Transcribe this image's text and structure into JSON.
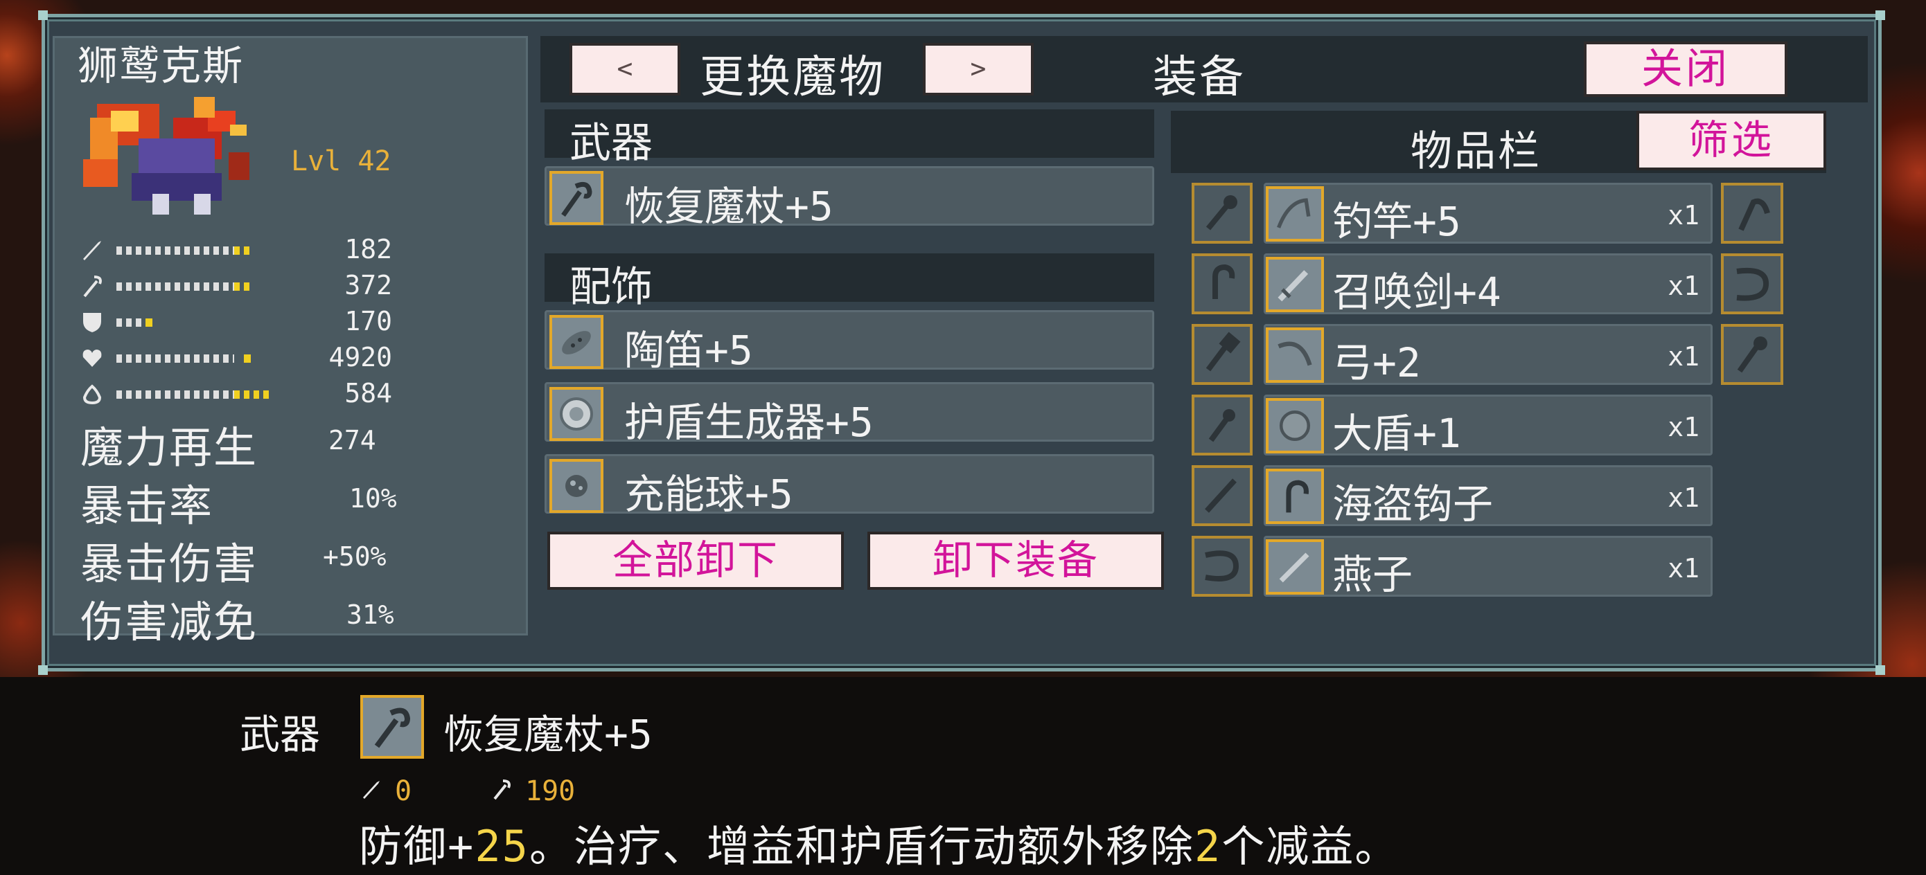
{
  "monster": {
    "name": "狮鹫克斯",
    "level": "Lvl 42",
    "stats": [
      {
        "icon": "sword-icon",
        "value": "182",
        "bar": 0.7
      },
      {
        "icon": "staff-icon",
        "value": "372",
        "bar": 0.7
      },
      {
        "icon": "shield-icon",
        "value": "170",
        "bar": 0.4
      },
      {
        "icon": "heart-icon",
        "value": "4920",
        "bar": 0.8
      },
      {
        "icon": "mana-icon",
        "value": "584",
        "bar": 0.95
      }
    ],
    "extra_stats": [
      {
        "label": "魔力再生",
        "value": "274"
      },
      {
        "label": "暴击率",
        "value": "10%"
      },
      {
        "label": "暴击伤害",
        "value": "+50%"
      },
      {
        "label": "伤害减免",
        "value": "31%"
      }
    ]
  },
  "header": {
    "prev_label": "<",
    "change_label": "更换魔物",
    "next_label": ">",
    "equip_label": "装备",
    "close_label": "关闭"
  },
  "equipped": {
    "weapon_title": "武器",
    "weapon": "恢复魔杖+5",
    "accessory_title": "配饰",
    "accessories": [
      "陶笛+5",
      "护盾生成器+5",
      "充能球+5"
    ],
    "unequip_all_label": "全部卸下",
    "unequip_label": "卸下装备"
  },
  "inventory": {
    "title": "物品栏",
    "filter_label": "筛选",
    "items": [
      {
        "name": "钓竿+5",
        "qty": "x1"
      },
      {
        "name": "召唤剑+4",
        "qty": "x1"
      },
      {
        "name": "弓+2",
        "qty": "x1"
      },
      {
        "name": "大盾+1",
        "qty": "x1"
      },
      {
        "name": "海盗钩子",
        "qty": "x1"
      },
      {
        "name": "燕子",
        "qty": "x1"
      }
    ]
  },
  "tooltip": {
    "category": "武器",
    "name": "恢复魔杖+5",
    "attack": "0",
    "magic": "190",
    "desc_a": "防御+",
    "desc_b": "25",
    "desc_c": "。治疗、增益和护盾行动额外移除",
    "desc_d": "2",
    "desc_e": "个减益。"
  }
}
